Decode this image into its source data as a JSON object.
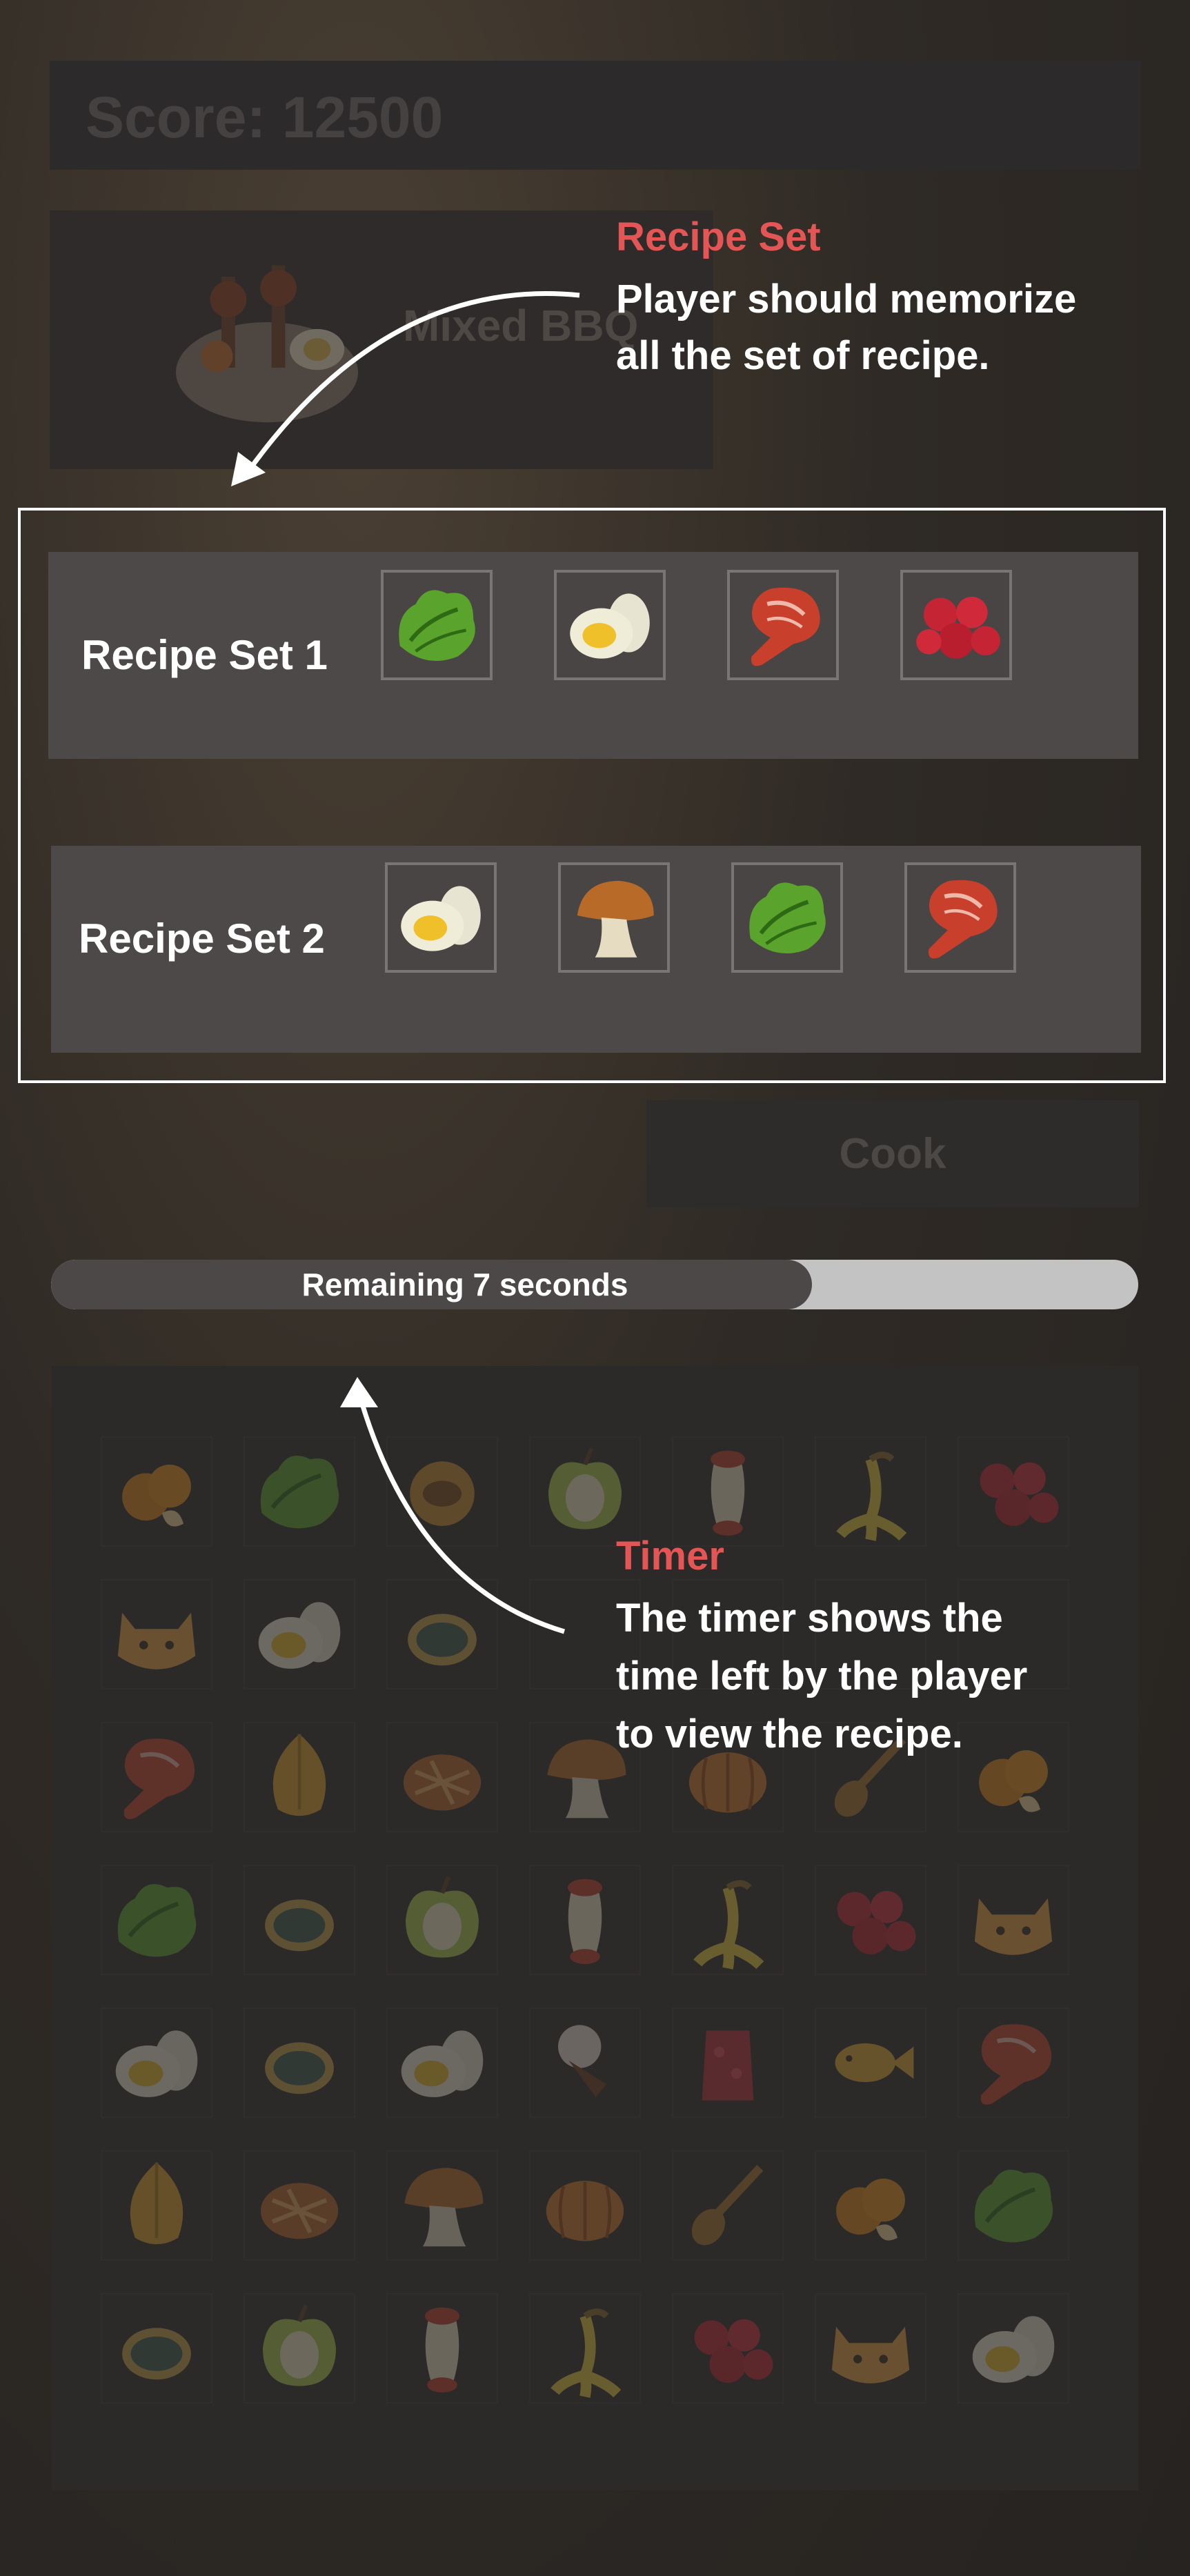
{
  "score": {
    "text": "Score: 12500"
  },
  "dish": {
    "label": "Mixed BBQ",
    "icon": "bbq-bowl-icon"
  },
  "recipes": [
    {
      "label": "Recipe Set 1",
      "items": [
        "lettuce",
        "egg",
        "meat",
        "berries"
      ]
    },
    {
      "label": "Recipe Set 2",
      "items": [
        "egg",
        "mushroom",
        "lettuce",
        "meat"
      ]
    }
  ],
  "cook_button": {
    "label": "Cook"
  },
  "timer": {
    "text": "Remaining 7 seconds",
    "fraction_remaining": 0.7
  },
  "grid": {
    "rows": [
      [
        "orange",
        "lettuce",
        "mooncake",
        "apple",
        "apple-core",
        "banana-peel",
        "berries"
      ],
      [
        "cat-face",
        "egg",
        "fish-can",
        "empty",
        "empty",
        "empty",
        "empty"
      ],
      [
        "meat",
        "onion",
        "pie",
        "mushroom",
        "pumpkin",
        "spoon",
        "orange"
      ],
      [
        "lettuce",
        "fish-can",
        "apple",
        "apple-core",
        "banana-peel",
        "berries",
        "cat-face"
      ],
      [
        "egg",
        "fish-can",
        "egg",
        "ice-cream",
        "gummy",
        "fish",
        "meat"
      ],
      [
        "onion",
        "pie",
        "mushroom",
        "pumpkin",
        "spoon",
        "orange",
        "lettuce"
      ],
      [
        "fish-can",
        "apple",
        "apple-core",
        "banana-peel",
        "berries",
        "cat-face",
        "egg"
      ]
    ]
  },
  "annotations": {
    "recipe_set": {
      "title": "Recipe Set",
      "line1": "Player should memorize",
      "line2": "all the set of recipe."
    },
    "timer": {
      "title": "Timer",
      "line1": "The timer shows the",
      "line2": "time left by the player",
      "line3": "to view the recipe."
    }
  },
  "colors": {
    "annotation_title": "#e45555",
    "panel": "#4e4949",
    "timer_track": "#c3c3c3"
  }
}
